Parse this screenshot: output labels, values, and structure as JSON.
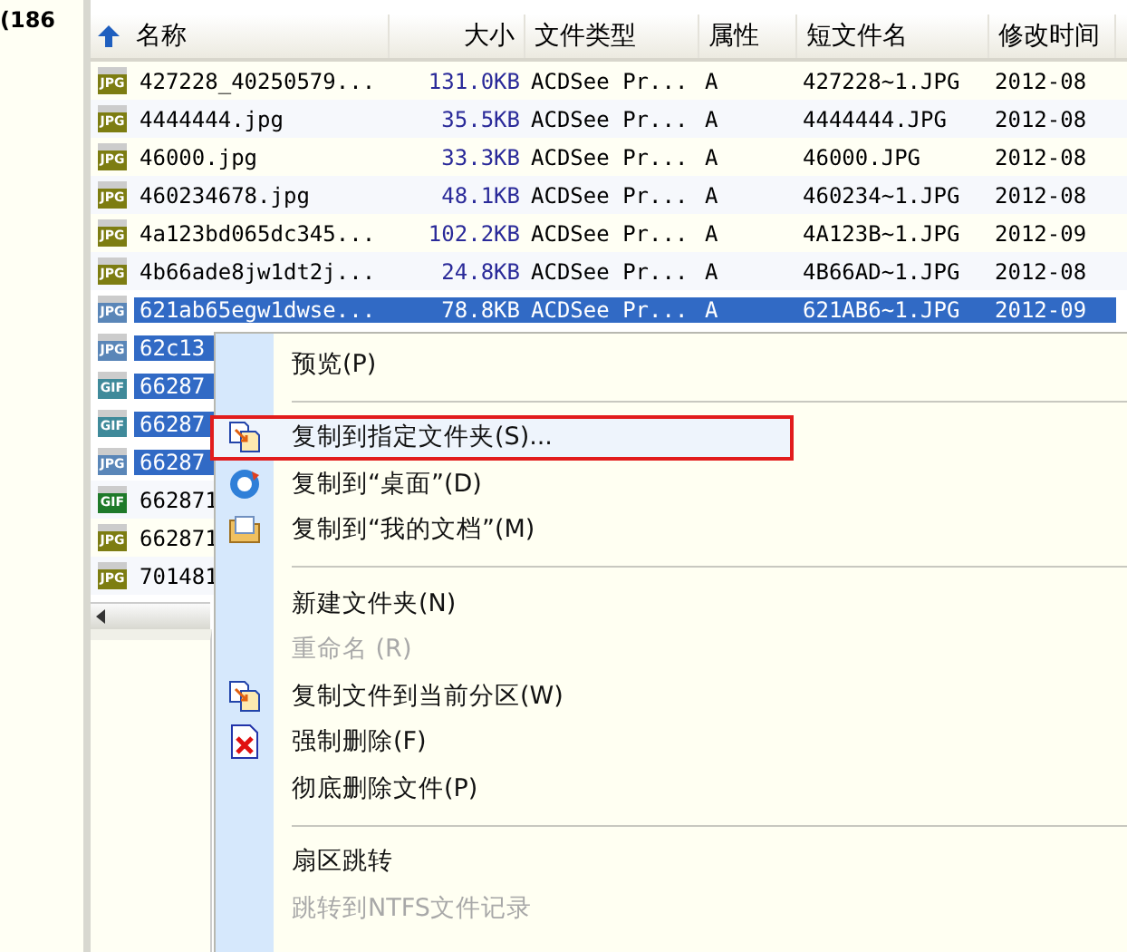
{
  "left_pane": {
    "text": "(186"
  },
  "columns": [
    {
      "label": "名称"
    },
    {
      "label": "大小"
    },
    {
      "label": "文件类型"
    },
    {
      "label": "属性"
    },
    {
      "label": "短文件名"
    },
    {
      "label": "修改时间"
    }
  ],
  "rows": [
    {
      "kind": "jpg",
      "badge": "JPG",
      "selected": false,
      "cells": [
        "427228_40250579...",
        "131.0KB",
        "ACDSee Pr...",
        "A",
        "427228~1.JPG",
        "2012-08"
      ]
    },
    {
      "kind": "jpg",
      "badge": "JPG",
      "selected": false,
      "cells": [
        "4444444.jpg",
        "35.5KB",
        "ACDSee Pr...",
        "A",
        "4444444.JPG",
        "2012-08"
      ]
    },
    {
      "kind": "jpg",
      "badge": "JPG",
      "selected": false,
      "cells": [
        "46000.jpg",
        "33.3KB",
        "ACDSee Pr...",
        "A",
        "46000.JPG",
        "2012-08"
      ]
    },
    {
      "kind": "jpg",
      "badge": "JPG",
      "selected": false,
      "cells": [
        "460234678.jpg",
        "48.1KB",
        "ACDSee Pr...",
        "A",
        "460234~1.JPG",
        "2012-08"
      ]
    },
    {
      "kind": "jpg",
      "badge": "JPG",
      "selected": false,
      "cells": [
        "4a123bd065dc345...",
        "102.2KB",
        "ACDSee Pr...",
        "A",
        "4A123B~1.JPG",
        "2012-09"
      ]
    },
    {
      "kind": "jpg",
      "badge": "JPG",
      "selected": false,
      "cells": [
        "4b66ade8jw1dt2j...",
        "24.8KB",
        "ACDSee Pr...",
        "A",
        "4B66AD~1.JPG",
        "2012-08"
      ]
    },
    {
      "kind": "jpg",
      "badge": "JPG",
      "selected": true,
      "cells": [
        "621ab65egw1dwse...",
        "78.8KB",
        "ACDSee Pr...",
        "A",
        "621AB6~1.JPG",
        "2012-09"
      ]
    },
    {
      "kind": "jpg",
      "badge": "JPG",
      "selected": true,
      "cells": [
        "62c13"
      ]
    },
    {
      "kind": "gif",
      "badge": "GIF",
      "selected": true,
      "cells": [
        "66287"
      ]
    },
    {
      "kind": "gif",
      "badge": "GIF",
      "selected": true,
      "cells": [
        "66287"
      ]
    },
    {
      "kind": "jpg",
      "badge": "JPG",
      "selected": true,
      "cells": [
        "66287"
      ]
    },
    {
      "kind": "gif",
      "badge": "GIF",
      "selected": false,
      "cells": [
        "662871"
      ]
    },
    {
      "kind": "jpg",
      "badge": "JPG",
      "selected": false,
      "cells": [
        "662871"
      ]
    },
    {
      "kind": "jpg",
      "badge": "JPG",
      "selected": false,
      "cells": [
        "701481"
      ]
    }
  ],
  "context_menu": [
    {
      "kind": "item",
      "label": "预览(P)",
      "disabled": false,
      "highlighted": false
    },
    {
      "kind": "separator"
    },
    {
      "kind": "item",
      "label": "复制到指定文件夹(S)...",
      "disabled": false,
      "highlighted": true
    },
    {
      "kind": "item",
      "label": "复制到“桌面”(D)",
      "disabled": false,
      "highlighted": false
    },
    {
      "kind": "item",
      "label": "复制到“我的文档”(M)",
      "disabled": false,
      "highlighted": false
    },
    {
      "kind": "separator"
    },
    {
      "kind": "item",
      "label": "新建文件夹(N)",
      "disabled": false,
      "highlighted": false
    },
    {
      "kind": "item",
      "label": "重命名 (R)",
      "disabled": true,
      "highlighted": false
    },
    {
      "kind": "item",
      "label": "复制文件到当前分区(W)",
      "disabled": false,
      "highlighted": false
    },
    {
      "kind": "item",
      "label": "强制删除(F)",
      "disabled": false,
      "highlighted": false
    },
    {
      "kind": "item",
      "label": "彻底删除文件(P)",
      "disabled": false,
      "highlighted": false
    },
    {
      "kind": "separator"
    },
    {
      "kind": "item",
      "label": "扇区跳转",
      "disabled": false,
      "highlighted": false
    },
    {
      "kind": "item",
      "label": "跳转到NTFS文件记录",
      "disabled": true,
      "highlighted": false
    }
  ]
}
